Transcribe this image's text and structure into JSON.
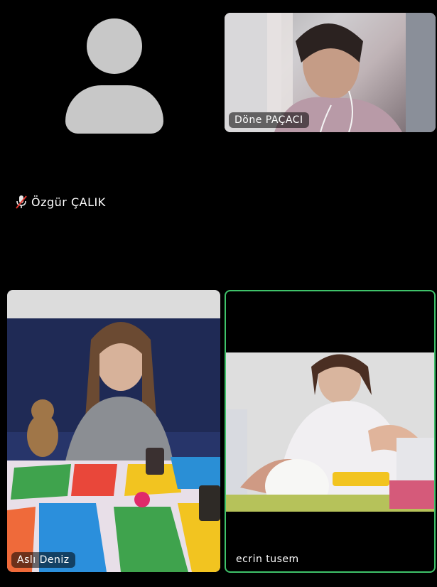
{
  "participants": [
    {
      "name": "Özgür ÇALIK",
      "muted": true,
      "video": false
    },
    {
      "name": "Döne PAÇACI",
      "muted": false,
      "video": true
    },
    {
      "name": "Aslı Deniz",
      "muted": false,
      "video": true
    },
    {
      "name": "ecrin tusem",
      "muted": false,
      "video": true,
      "active_speaker": true
    }
  ],
  "colors": {
    "active_border": "#3fc36a",
    "avatar": "#c8c8c8",
    "background": "#000000"
  }
}
